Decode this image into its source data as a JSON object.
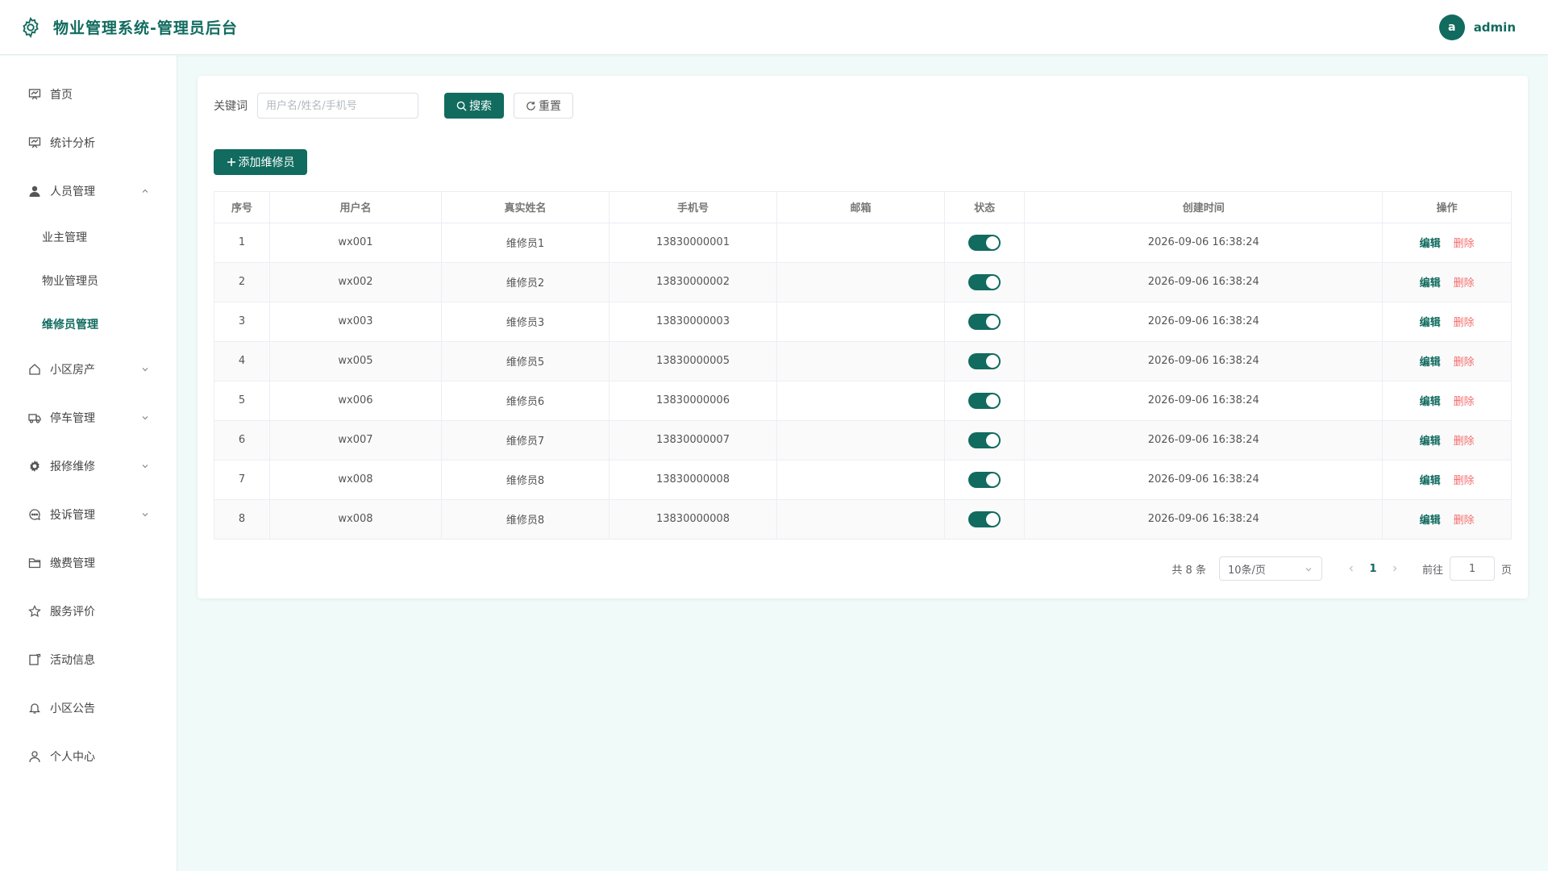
{
  "header": {
    "title": "物业管理系统-管理员后台",
    "avatar_letter": "a",
    "username": "admin"
  },
  "sidebar": {
    "items": [
      {
        "label": "首页",
        "icon": "chart-board-icon"
      },
      {
        "label": "统计分析",
        "icon": "chart-board-icon"
      },
      {
        "label": "人员管理",
        "icon": "user-icon",
        "expanded": true
      },
      {
        "label": "小区房产",
        "icon": "house-icon"
      },
      {
        "label": "停车管理",
        "icon": "truck-icon"
      },
      {
        "label": "报修维修",
        "icon": "gear-icon"
      },
      {
        "label": "投诉管理",
        "icon": "chat-icon"
      },
      {
        "label": "缴费管理",
        "icon": "folder-icon"
      },
      {
        "label": "服务评价",
        "icon": "star-icon"
      },
      {
        "label": "活动信息",
        "icon": "note-icon"
      },
      {
        "label": "小区公告",
        "icon": "bell-icon"
      },
      {
        "label": "个人中心",
        "icon": "person-icon"
      }
    ],
    "sub_items": [
      {
        "label": "业主管理"
      },
      {
        "label": "物业管理员"
      },
      {
        "label": "维修员管理",
        "active": true
      }
    ]
  },
  "search": {
    "label": "关键词",
    "placeholder": "用户名/姓名/手机号",
    "value": "",
    "search_button": "搜索",
    "reset_button": "重置"
  },
  "toolbar": {
    "add_button": "添加维修员"
  },
  "table": {
    "columns": [
      "序号",
      "用户名",
      "真实姓名",
      "手机号",
      "邮箱",
      "状态",
      "创建时间",
      "操作"
    ],
    "rows": [
      {
        "index": "1",
        "username": "wx001",
        "realname": "维修员1",
        "phone": "13830000001",
        "email": "",
        "status": true,
        "created": "2026-09-06 16:38:24"
      },
      {
        "index": "2",
        "username": "wx002",
        "realname": "维修员2",
        "phone": "13830000002",
        "email": "",
        "status": true,
        "created": "2026-09-06 16:38:24"
      },
      {
        "index": "3",
        "username": "wx003",
        "realname": "维修员3",
        "phone": "13830000003",
        "email": "",
        "status": true,
        "created": "2026-09-06 16:38:24"
      },
      {
        "index": "4",
        "username": "wx005",
        "realname": "维修员5",
        "phone": "13830000005",
        "email": "",
        "status": true,
        "created": "2026-09-06 16:38:24"
      },
      {
        "index": "5",
        "username": "wx006",
        "realname": "维修员6",
        "phone": "13830000006",
        "email": "",
        "status": true,
        "created": "2026-09-06 16:38:24"
      },
      {
        "index": "6",
        "username": "wx007",
        "realname": "维修员7",
        "phone": "13830000007",
        "email": "",
        "status": true,
        "created": "2026-09-06 16:38:24"
      },
      {
        "index": "7",
        "username": "wx008",
        "realname": "维修员8",
        "phone": "13830000008",
        "email": "",
        "status": true,
        "created": "2026-09-06 16:38:24"
      },
      {
        "index": "8",
        "username": "wx008",
        "realname": "维修员8",
        "phone": "13830000008",
        "email": "",
        "status": true,
        "created": "2026-09-06 16:38:24"
      }
    ],
    "edit_label": "编辑",
    "delete_label": "删除"
  },
  "pagination": {
    "total_text": "共 8 条",
    "page_size": "10条/页",
    "current_page": "1",
    "goto_label": "前往",
    "goto_value": "1",
    "goto_unit": "页"
  },
  "colors": {
    "primary": "#116b5f",
    "danger": "#f56c6c",
    "background": "#f0faf8"
  }
}
